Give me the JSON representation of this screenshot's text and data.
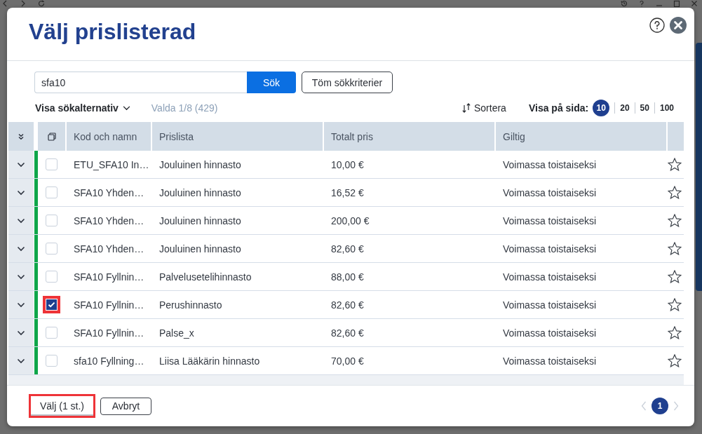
{
  "dialog": {
    "title": "Välj prislisterad"
  },
  "search": {
    "value": "sfa10",
    "search_button": "Sök",
    "clear_button": "Töm sökkriterier"
  },
  "options_toggle": {
    "label": "Visa sökalternativ",
    "expanded": false
  },
  "selection_count": "Valda 1/8 (429)",
  "sort_button": "Sortera",
  "page_size": {
    "label": "Visa på sida:",
    "options": [
      {
        "label": "10",
        "selected": true
      },
      {
        "label": "20",
        "selected": false
      },
      {
        "label": "50",
        "selected": false
      },
      {
        "label": "100",
        "selected": false
      }
    ]
  },
  "table": {
    "columns": [
      "Kod och namn",
      "Prislista",
      "Totalt pris",
      "Giltig"
    ],
    "rows": [
      {
        "code_name": "ETU_SFA10 In…",
        "price_list": "Jouluinen hinnasto",
        "total_price": "10,00 €",
        "validity": "Voimassa toistaiseksi",
        "checked": false,
        "highlighted": false,
        "color": "#0fa64a",
        "favorite": false
      },
      {
        "code_name": "SFA10 Yhden…",
        "price_list": "Jouluinen hinnasto",
        "total_price": "16,52 €",
        "validity": "Voimassa toistaiseksi",
        "checked": false,
        "highlighted": false,
        "color": "#0fa64a",
        "favorite": false
      },
      {
        "code_name": "SFA10 Yhden…",
        "price_list": "Jouluinen hinnasto",
        "total_price": "200,00 €",
        "validity": "Voimassa toistaiseksi",
        "checked": false,
        "highlighted": false,
        "color": "#0fa64a",
        "favorite": false
      },
      {
        "code_name": "SFA10 Yhden…",
        "price_list": "Jouluinen hinnasto",
        "total_price": "82,60 €",
        "validity": "Voimassa toistaiseksi",
        "checked": false,
        "highlighted": false,
        "color": "#0fa64a",
        "favorite": false
      },
      {
        "code_name": "SFA10 Fyllnin…",
        "price_list": "Palvelusetelihinnasto",
        "total_price": "88,00 €",
        "validity": "Voimassa toistaiseksi",
        "checked": false,
        "highlighted": false,
        "color": "#0fa64a",
        "favorite": false
      },
      {
        "code_name": "SFA10 Fyllnin…",
        "price_list": "Perushinnasto",
        "total_price": "82,60 €",
        "validity": "Voimassa toistaiseksi",
        "checked": true,
        "highlighted": true,
        "color": "#0fa64a",
        "favorite": false
      },
      {
        "code_name": "SFA10 Fyllnin…",
        "price_list": "Palse_x",
        "total_price": "82,60 €",
        "validity": "Voimassa toistaiseksi",
        "checked": false,
        "highlighted": false,
        "color": "#0fa64a",
        "favorite": false
      },
      {
        "code_name": "sfa10 Fyllning…",
        "price_list": "Liisa Lääkärin hinnasto",
        "total_price": "70,00 €",
        "validity": "Voimassa toistaiseksi",
        "checked": false,
        "highlighted": false,
        "color": "#0fa64a",
        "favorite": false
      }
    ]
  },
  "footer": {
    "buttons": [
      {
        "label": "Välj (1 st.)",
        "kind": "primary",
        "highlighted": true
      },
      {
        "label": "Avbryt",
        "kind": "secondary",
        "highlighted": false
      }
    ],
    "pagination": {
      "previous_disabled": true,
      "pages": [
        {
          "label": "1",
          "selected": true
        }
      ],
      "next_disabled": true
    }
  }
}
